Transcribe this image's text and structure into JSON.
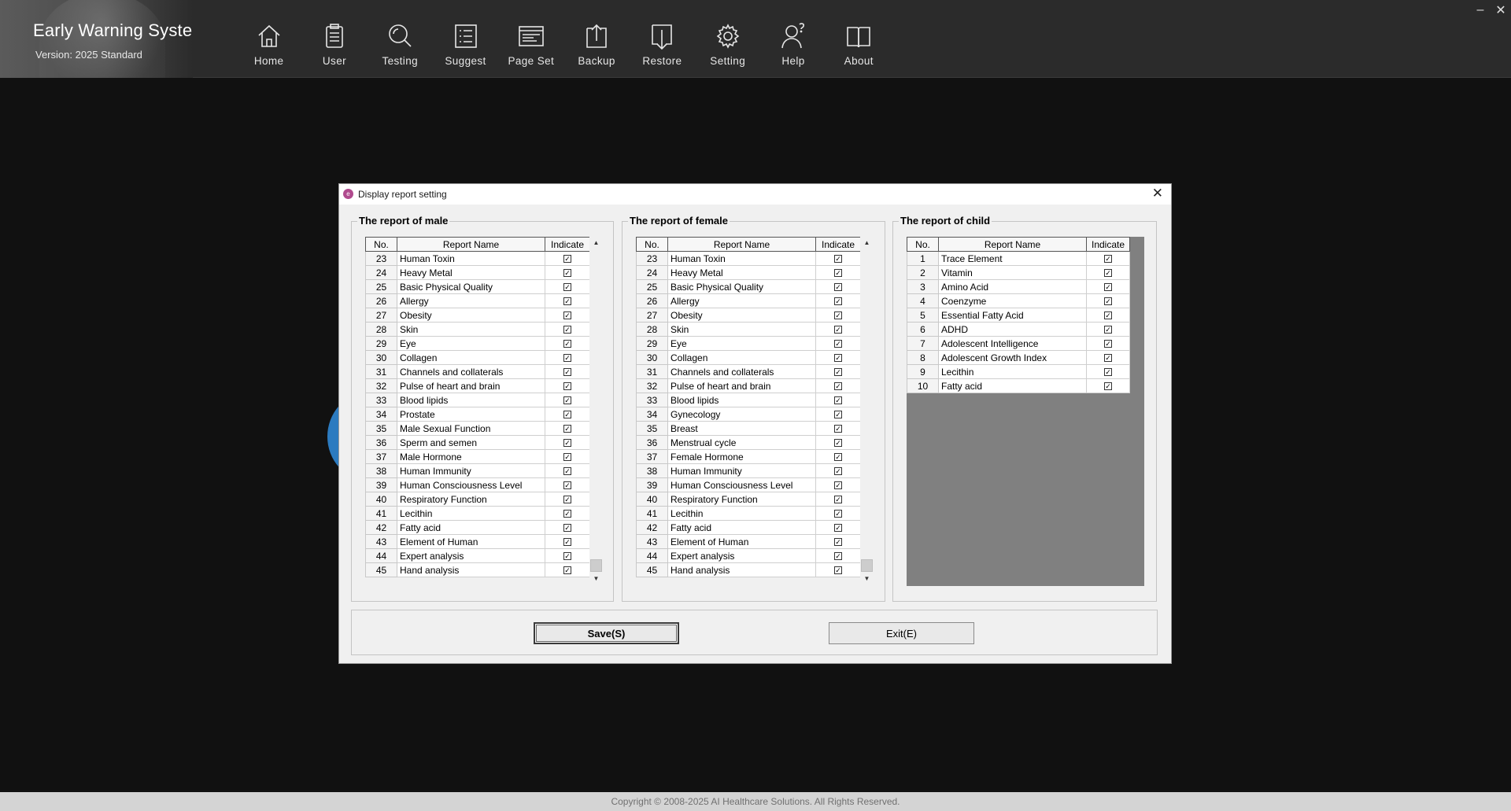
{
  "app": {
    "title": "Early Warning System",
    "version": "Version: 2025 Standard"
  },
  "nav": {
    "items": [
      {
        "label": "Home",
        "icon": "home-icon"
      },
      {
        "label": "User",
        "icon": "clipboard-icon"
      },
      {
        "label": "Testing",
        "icon": "magnifier-icon"
      },
      {
        "label": "Suggest",
        "icon": "list-icon"
      },
      {
        "label": "Page Set",
        "icon": "page-layout-icon"
      },
      {
        "label": "Backup",
        "icon": "upload-icon"
      },
      {
        "label": "Restore",
        "icon": "download-icon"
      },
      {
        "label": "Setting",
        "icon": "gear-icon"
      },
      {
        "label": "Help",
        "icon": "help-user-icon"
      },
      {
        "label": "About",
        "icon": "book-icon"
      }
    ]
  },
  "window_controls": {
    "minimize": "–",
    "close": "✕"
  },
  "dialog": {
    "title": "Display report setting",
    "close": "✕",
    "columns": {
      "no": "No.",
      "name": "Report Name",
      "indicate": "Indicate"
    },
    "check_mark": "✓",
    "male": {
      "title": "The report of male",
      "rows": [
        {
          "no": "23",
          "name": "Human Toxin"
        },
        {
          "no": "24",
          "name": "Heavy Metal"
        },
        {
          "no": "25",
          "name": "Basic Physical Quality"
        },
        {
          "no": "26",
          "name": "Allergy"
        },
        {
          "no": "27",
          "name": "Obesity"
        },
        {
          "no": "28",
          "name": "Skin"
        },
        {
          "no": "29",
          "name": "Eye"
        },
        {
          "no": "30",
          "name": "Collagen"
        },
        {
          "no": "31",
          "name": "Channels and collaterals"
        },
        {
          "no": "32",
          "name": "Pulse of heart and brain"
        },
        {
          "no": "33",
          "name": "Blood lipids"
        },
        {
          "no": "34",
          "name": "Prostate"
        },
        {
          "no": "35",
          "name": "Male Sexual Function"
        },
        {
          "no": "36",
          "name": "Sperm and semen"
        },
        {
          "no": "37",
          "name": "Male Hormone"
        },
        {
          "no": "38",
          "name": "Human Immunity"
        },
        {
          "no": "39",
          "name": "Human Consciousness Level"
        },
        {
          "no": "40",
          "name": "Respiratory Function"
        },
        {
          "no": "41",
          "name": "Lecithin"
        },
        {
          "no": "42",
          "name": "Fatty acid"
        },
        {
          "no": "43",
          "name": "Element of Human"
        },
        {
          "no": "44",
          "name": "Expert analysis"
        },
        {
          "no": "45",
          "name": "Hand analysis"
        }
      ]
    },
    "female": {
      "title": "The report of female",
      "rows": [
        {
          "no": "23",
          "name": "Human Toxin"
        },
        {
          "no": "24",
          "name": "Heavy Metal"
        },
        {
          "no": "25",
          "name": "Basic Physical Quality"
        },
        {
          "no": "26",
          "name": "Allergy"
        },
        {
          "no": "27",
          "name": "Obesity"
        },
        {
          "no": "28",
          "name": "Skin"
        },
        {
          "no": "29",
          "name": "Eye"
        },
        {
          "no": "30",
          "name": "Collagen"
        },
        {
          "no": "31",
          "name": "Channels and collaterals"
        },
        {
          "no": "32",
          "name": "Pulse of heart and brain"
        },
        {
          "no": "33",
          "name": "Blood lipids"
        },
        {
          "no": "34",
          "name": "Gynecology"
        },
        {
          "no": "35",
          "name": "Breast"
        },
        {
          "no": "36",
          "name": "Menstrual cycle"
        },
        {
          "no": "37",
          "name": "Female Hormone"
        },
        {
          "no": "38",
          "name": "Human Immunity"
        },
        {
          "no": "39",
          "name": "Human Consciousness Level"
        },
        {
          "no": "40",
          "name": "Respiratory Function"
        },
        {
          "no": "41",
          "name": "Lecithin"
        },
        {
          "no": "42",
          "name": "Fatty acid"
        },
        {
          "no": "43",
          "name": "Element of Human"
        },
        {
          "no": "44",
          "name": "Expert analysis"
        },
        {
          "no": "45",
          "name": "Hand analysis"
        }
      ]
    },
    "child": {
      "title": "The report of child",
      "rows": [
        {
          "no": "1",
          "name": "Trace Element"
        },
        {
          "no": "2",
          "name": "Vitamin"
        },
        {
          "no": "3",
          "name": "Amino Acid"
        },
        {
          "no": "4",
          "name": "Coenzyme"
        },
        {
          "no": "5",
          "name": "Essential Fatty Acid"
        },
        {
          "no": "6",
          "name": "ADHD"
        },
        {
          "no": "7",
          "name": "Adolescent Intelligence"
        },
        {
          "no": "8",
          "name": "Adolescent Growth Index"
        },
        {
          "no": "9",
          "name": "Lecithin"
        },
        {
          "no": "10",
          "name": "Fatty acid"
        }
      ]
    },
    "buttons": {
      "save": "Save(S)",
      "exit": "Exit(E)"
    }
  },
  "footer": {
    "copyright": "Copyright © 2008-2025 AI Healthcare Solutions. All Rights Reserved."
  },
  "colors": {
    "titlebar": "#2b2b2b",
    "background": "#111111",
    "dialog": "#f0f0f0",
    "accent_circle": "#2c7bc0"
  }
}
